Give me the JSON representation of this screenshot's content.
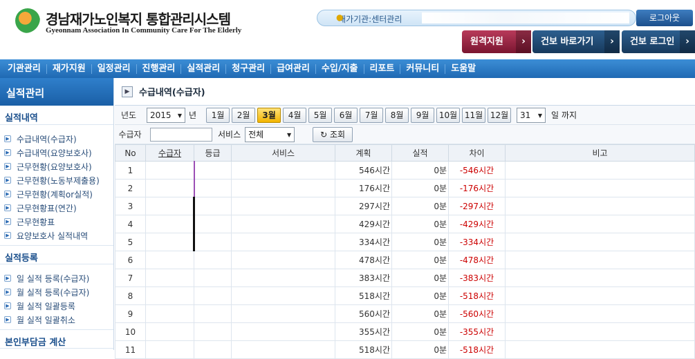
{
  "header": {
    "title": "경남재가노인복지 통합관리시스템",
    "subtitle": "Gyeonnam Association In Community Care For The Elderly",
    "user_label": "재가기관:센터관리",
    "logout_label": "로그아웃",
    "buttons": {
      "remote": "원격지원",
      "gunbo_go": "건보 바로가기",
      "gunbo_login": "건보 로그인"
    }
  },
  "nav": [
    "기관관리",
    "재가지원",
    "일정관리",
    "진행관리",
    "실적관리",
    "청구관리",
    "급여관리",
    "수입/지출",
    "리포트",
    "커뮤니티",
    "도움말"
  ],
  "sidebar": {
    "title": "실적관리",
    "sections": [
      {
        "title": "실적내역",
        "items": [
          "수급내역(수급자)",
          "수급내역(요양보호사)",
          "근무현황(요양보호사)",
          "근무현황(노동부제출용)",
          "근무현황(계획or실적)",
          "근무현황표(연간)",
          "근무현황표",
          "요양보호사 실적내역"
        ]
      },
      {
        "title": "실적등록",
        "items": [
          "일 실적 등록(수급자)",
          "월 실적 등록(수급자)",
          "월 실적 일괄등록",
          "월 실적 일괄취소"
        ]
      },
      {
        "title": "본인부담금 계산",
        "items": []
      }
    ]
  },
  "content": {
    "title": "수급내역(수급자)",
    "filter": {
      "year_label": "년도",
      "year_value": "2015",
      "year_suffix": "년",
      "months": [
        "1월",
        "2월",
        "3월",
        "4월",
        "5월",
        "6월",
        "7월",
        "8월",
        "9월",
        "10월",
        "11월",
        "12월"
      ],
      "active_month": "3월",
      "day_value": "31",
      "day_suffix": "일 까지",
      "recipient_label": "수급자",
      "recipient_value": "",
      "service_label": "서비스",
      "service_value": "전체",
      "search_label": "조회"
    },
    "table": {
      "headers": [
        "No",
        "수급자",
        "등급",
        "서비스",
        "계획",
        "실적",
        "차이",
        "비고"
      ],
      "rows": [
        {
          "no": "1",
          "plan": "546시간",
          "actual": "0분",
          "diff": "-546시간"
        },
        {
          "no": "2",
          "plan": "176시간",
          "actual": "0분",
          "diff": "-176시간"
        },
        {
          "no": "3",
          "plan": "297시간",
          "actual": "0분",
          "diff": "-297시간"
        },
        {
          "no": "4",
          "plan": "429시간",
          "actual": "0분",
          "diff": "-429시간"
        },
        {
          "no": "5",
          "plan": "334시간",
          "actual": "0분",
          "diff": "-334시간"
        },
        {
          "no": "6",
          "plan": "478시간",
          "actual": "0분",
          "diff": "-478시간"
        },
        {
          "no": "7",
          "plan": "383시간",
          "actual": "0분",
          "diff": "-383시간"
        },
        {
          "no": "8",
          "plan": "518시간",
          "actual": "0분",
          "diff": "-518시간"
        },
        {
          "no": "9",
          "plan": "560시간",
          "actual": "0분",
          "diff": "-560시간"
        },
        {
          "no": "10",
          "plan": "355시간",
          "actual": "0분",
          "diff": "-355시간"
        },
        {
          "no": "11",
          "plan": "518시간",
          "actual": "0분",
          "diff": "-518시간"
        }
      ]
    }
  },
  "colors": {
    "nav_bg": "#1f69b3",
    "active_month": "#f2b400",
    "diff_red": "#cc0000",
    "remote_btn": "#7a1530"
  }
}
